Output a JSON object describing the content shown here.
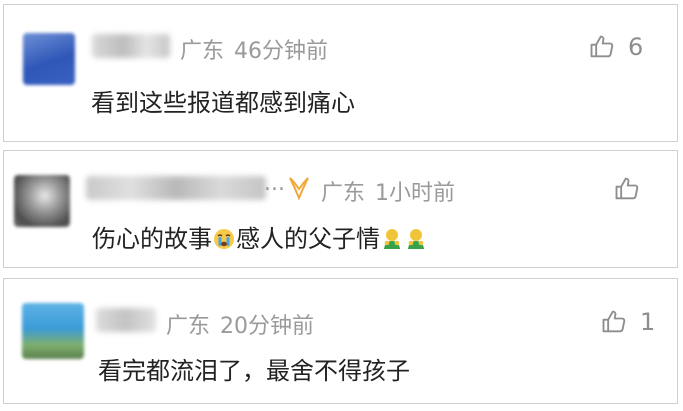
{
  "comments": [
    {
      "location": "广东",
      "time": "46分钟前",
      "text": "看到这些报道都感到痛心",
      "likes": "6"
    },
    {
      "ellipsis": "...",
      "location": "广东",
      "time": "1小时前",
      "text_before_emoji": "伤心的故事",
      "text_after_emoji": "感人的父子情",
      "likes": ""
    },
    {
      "location": "广东",
      "time": "20分钟前",
      "text": "看完都流泪了，最舍不得孩子",
      "likes": "1"
    }
  ],
  "icons": {
    "like": "thumbs-up-icon",
    "badge": "orange-badge-icon",
    "crying_emoji": "crying-face-icon",
    "hug_emoji": "hugging-figure-icon"
  },
  "colors": {
    "meta_text": "#9a9a9a",
    "body_text": "#222222",
    "border": "#cfcfcf",
    "badge": "#f2a93b"
  }
}
